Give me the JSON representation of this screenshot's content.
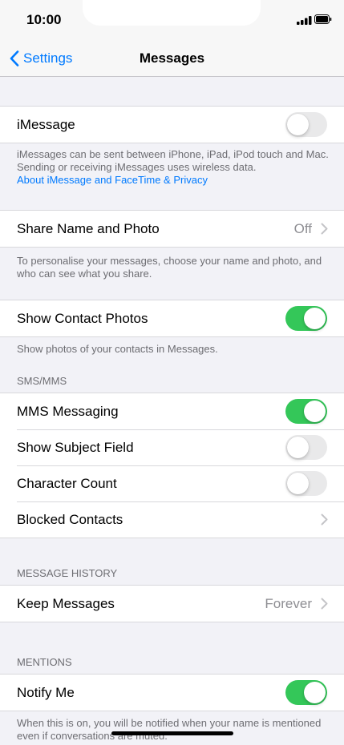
{
  "status": {
    "time": "10:00"
  },
  "nav": {
    "back_label": "Settings",
    "title": "Messages"
  },
  "imessage": {
    "label": "iMessage",
    "toggle_on": false,
    "footnote": "iMessages can be sent between iPhone, iPad, iPod touch and Mac. Sending or receiving iMessages uses wireless data.",
    "link": "About iMessage and FaceTime & Privacy"
  },
  "share": {
    "label": "Share Name and Photo",
    "value": "Off",
    "footnote": "To personalise your messages, choose your name and photo, and who can see what you share."
  },
  "contact_photos": {
    "label": "Show Contact Photos",
    "toggle_on": true,
    "footnote": "Show photos of your contacts in Messages."
  },
  "sms": {
    "header": "SMS/MMS",
    "mms_label": "MMS Messaging",
    "mms_on": true,
    "subject_label": "Show Subject Field",
    "subject_on": false,
    "charcount_label": "Character Count",
    "charcount_on": false,
    "blocked_label": "Blocked Contacts"
  },
  "history": {
    "header": "MESSAGE HISTORY",
    "keep_label": "Keep Messages",
    "keep_value": "Forever"
  },
  "mentions": {
    "header": "MENTIONS",
    "notify_label": "Notify Me",
    "notify_on": true,
    "footnote": "When this is on, you will be notified when your name is mentioned even if conversations are muted."
  },
  "colors": {
    "accent": "#007aff",
    "toggle_on": "#34c759",
    "toggle_off": "#e9e9ea"
  }
}
